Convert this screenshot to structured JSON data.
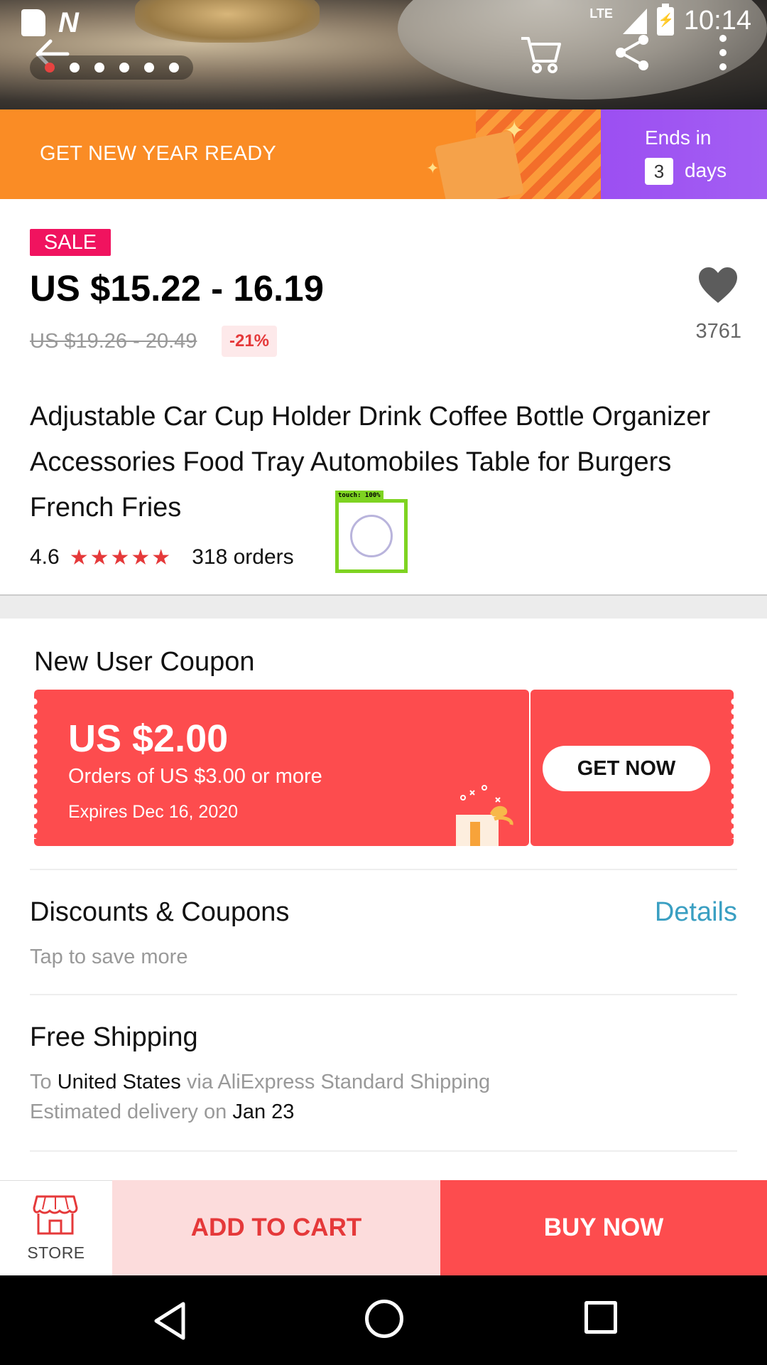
{
  "status_bar": {
    "time": "10:14",
    "network": "LTE"
  },
  "gallery": {
    "total_images": 6,
    "active_index": 0
  },
  "icons": {
    "back": "arrow-left-icon",
    "cart": "cart-icon",
    "share": "share-icon",
    "more": "more-vert-icon",
    "heart": "heart-icon",
    "store": "store-icon",
    "gift": "gift-icon"
  },
  "promo": {
    "text": "GET NEW YEAR READY",
    "ends_label": "Ends in",
    "ends_days": "3",
    "ends_unit": "days"
  },
  "product": {
    "badge": "SALE",
    "price": "US $15.22 - 16.19",
    "original_price": "US $19.26 - 20.49",
    "discount": "-21%",
    "wishlist_count": "3761",
    "title": "Adjustable Car Cup Holder Drink Coffee Bottle Organizer Accessories Food Tray Automobiles Table for Burgers French Fries",
    "rating": "4.6",
    "stars": "★★★★★",
    "orders": "318 orders"
  },
  "touch_overlay": {
    "label": "touch: 100%"
  },
  "coupon": {
    "heading": "New User Coupon",
    "amount": "US $2.00",
    "condition": "Orders of US $3.00 or more",
    "expires": "Expires Dec 16, 2020",
    "button": "GET NOW"
  },
  "discounts": {
    "title": "Discounts & Coupons",
    "subtitle": "Tap to save more",
    "link": "Details"
  },
  "shipping": {
    "title": "Free Shipping",
    "to_prefix": "To",
    "destination": "United States",
    "via": "via AliExpress Standard Shipping",
    "delivery_prefix": "Estimated delivery on",
    "delivery_date": "Jan 23"
  },
  "actions": {
    "store": "STORE",
    "add_to_cart": "ADD TO CART",
    "buy_now": "BUY NOW"
  },
  "colors": {
    "accent_red": "#fd4c4e",
    "promo_orange": "#fa8c25",
    "promo_purple": "#a35ef3",
    "link_blue": "#3a9fc2"
  }
}
